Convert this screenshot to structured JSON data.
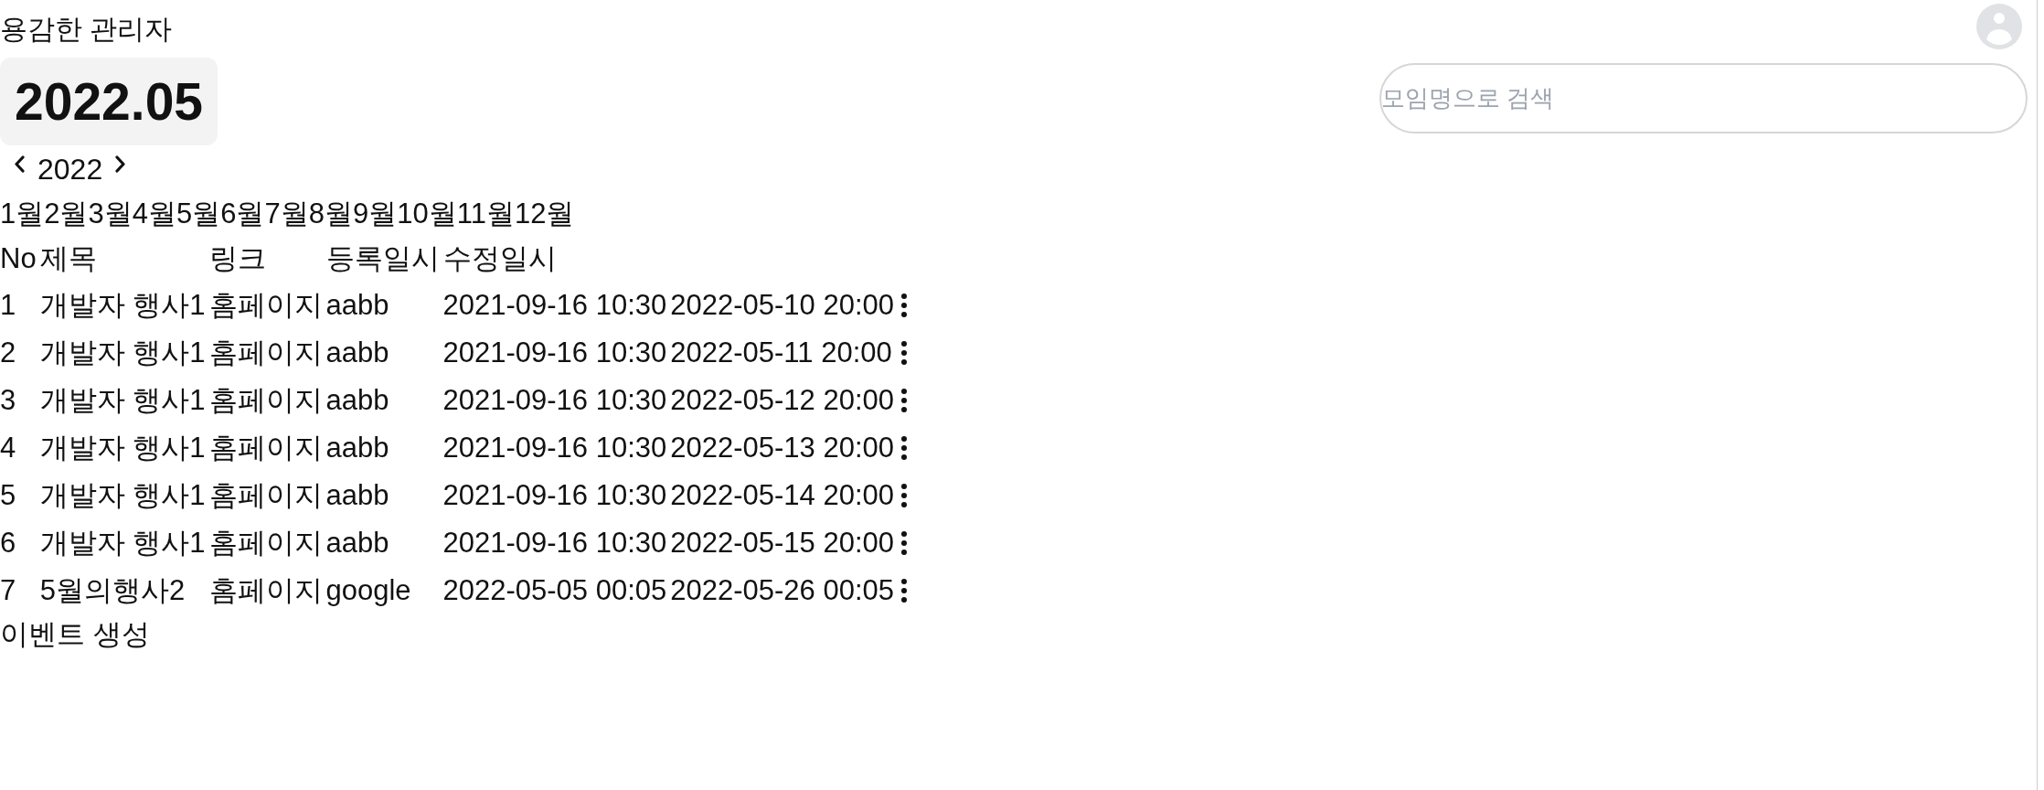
{
  "header": {
    "admin_name": "용감한 관리자"
  },
  "current_month": "2022.05",
  "search": {
    "placeholder": "모임명으로 검색"
  },
  "year_nav": {
    "year": "2022"
  },
  "months": [
    "1월",
    "2월",
    "3월",
    "4월",
    "5월",
    "6월",
    "7월",
    "8월",
    "9월",
    "10월",
    "11월",
    "12월"
  ],
  "table": {
    "columns": [
      "No",
      "제목",
      "링크",
      "등록일시",
      "수정일시"
    ],
    "rows": [
      {
        "cells": [
          "1",
          "개발자 행사1",
          "홈페이지",
          "aabb",
          "2021-09-16 10:30",
          "2022-05-10 20:00"
        ]
      },
      {
        "cells": [
          "2",
          "개발자 행사1",
          "홈페이지",
          "aabb",
          "2021-09-16 10:30",
          "2022-05-11 20:00"
        ]
      },
      {
        "cells": [
          "3",
          "개발자 행사1",
          "홈페이지",
          "aabb",
          "2021-09-16 10:30",
          "2022-05-12 20:00"
        ]
      },
      {
        "cells": [
          "4",
          "개발자 행사1",
          "홈페이지",
          "aabb",
          "2021-09-16 10:30",
          "2022-05-13 20:00"
        ]
      },
      {
        "cells": [
          "5",
          "개발자 행사1",
          "홈페이지",
          "aabb",
          "2021-09-16 10:30",
          "2022-05-14 20:00"
        ]
      },
      {
        "cells": [
          "6",
          "개발자 행사1",
          "홈페이지",
          "aabb",
          "2021-09-16 10:30",
          "2022-05-15 20:00"
        ]
      },
      {
        "cells": [
          "7",
          "5월의행사2",
          "홈페이지",
          "google",
          "2022-05-05 00:05",
          "2022-05-26 00:05"
        ]
      }
    ]
  },
  "create_button": "이벤트 생성"
}
